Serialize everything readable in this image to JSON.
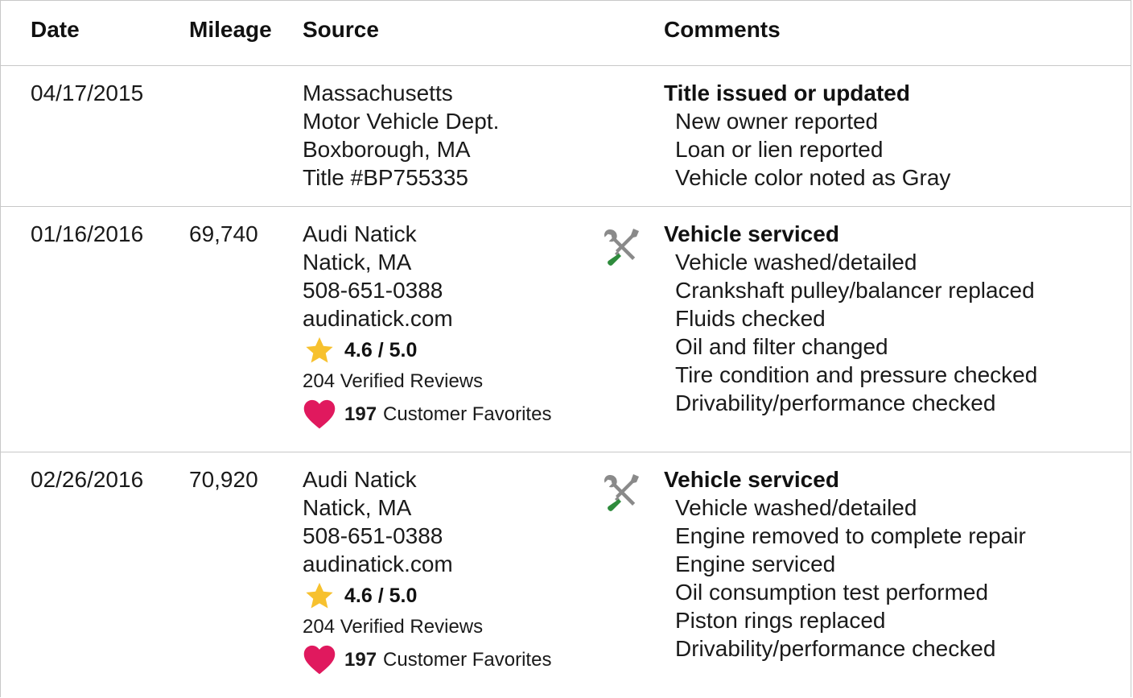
{
  "headers": {
    "date": "Date",
    "mileage": "Mileage",
    "source": "Source",
    "comments": "Comments"
  },
  "records": [
    {
      "date": "04/17/2015",
      "mileage": "",
      "source": [
        "Massachusetts",
        "Motor Vehicle Dept.",
        "Boxborough, MA",
        "Title #BP755335"
      ],
      "comment_title": "Title issued or updated",
      "comments": [
        "New owner reported",
        "Loan or lien reported",
        "Vehicle color noted as Gray"
      ]
    },
    {
      "date": "01/16/2016",
      "mileage": "69,740",
      "icon": "wrench-screwdriver-icon",
      "source": [
        "Audi Natick",
        "Natick, MA",
        "508-651-0388",
        "audinatick.com"
      ],
      "rating": "4.6 / 5.0",
      "reviews": "204 Verified Reviews",
      "favorites_count": "197",
      "favorites_label": "Customer Favorites",
      "comment_title": "Vehicle serviced",
      "comments": [
        "Vehicle washed/detailed",
        "Crankshaft pulley/balancer replaced",
        "Fluids checked",
        "Oil and filter changed",
        "Tire condition and pressure checked",
        "Drivability/performance checked"
      ]
    },
    {
      "date": "02/26/2016",
      "mileage": "70,920",
      "icon": "wrench-screwdriver-icon",
      "source": [
        "Audi Natick",
        "Natick, MA",
        "508-651-0388",
        "audinatick.com"
      ],
      "rating": "4.6 / 5.0",
      "reviews": "204 Verified Reviews",
      "favorites_count": "197",
      "favorites_label": "Customer Favorites",
      "comment_title": "Vehicle serviced",
      "comments": [
        "Vehicle washed/detailed",
        "Engine removed to complete repair",
        "Engine serviced",
        "Oil consumption test performed",
        "Piston rings replaced",
        "Drivability/performance checked"
      ]
    }
  ],
  "icons": {
    "star": "star-icon",
    "heart": "heart-icon",
    "service": "wrench-screwdriver-icon"
  },
  "colors": {
    "star": "#f7c12e",
    "heart": "#e0195e",
    "tool_gray": "#8a8a8a",
    "screwdriver_handle": "#2e8b3c",
    "divider": "#c8c8c8"
  }
}
